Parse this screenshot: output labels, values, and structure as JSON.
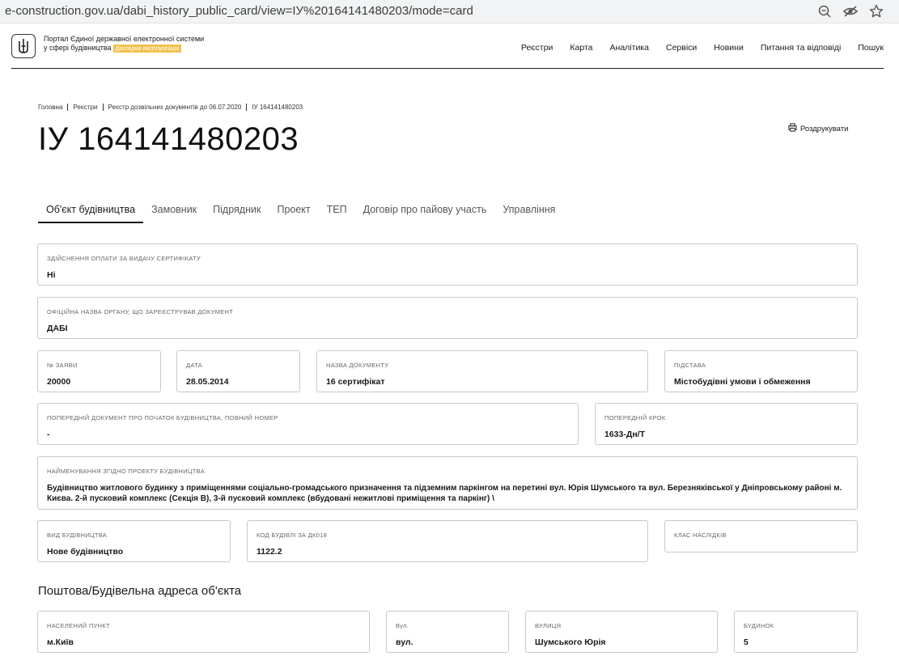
{
  "browser": {
    "url": "e-construction.gov.ua/dabi_history_public_card/view=ІУ%20164141480203/mode=card"
  },
  "header": {
    "portal_title": "Портал Єдиної державної електронної системи у сфері будівництва",
    "beta_badge": "Дослідна експлуатація",
    "nav": [
      "Реєстри",
      "Карта",
      "Аналітика",
      "Сервіси",
      "Новини",
      "Питання та відповіді",
      "Пошук"
    ]
  },
  "breadcrumb": [
    "Головна",
    "Реєстри",
    "Реєстр дозвільних документів до 06.07.2020",
    "ІУ 164141480203"
  ],
  "page": {
    "title": "ІУ 164141480203",
    "print_label": "Роздрукувати"
  },
  "tabs": [
    "Об'єкт будівництва",
    "Замовник",
    "Підрядник",
    "Проект",
    "ТЕП",
    "Договір про пайову участь",
    "Управління"
  ],
  "fields": {
    "payment": {
      "label": "Здійснення оплати за видачу сертифікату",
      "value": "Ні"
    },
    "authority": {
      "label": "Офіційна назва органу, що зареєстрував документ",
      "value": "ДАБІ"
    },
    "app_no": {
      "label": "№ заяви",
      "value": "20000"
    },
    "date": {
      "label": "Дата",
      "value": "28.05.2014"
    },
    "doc_name": {
      "label": "Назва документу",
      "value": "16 сертифікат"
    },
    "basis": {
      "label": "Підстава",
      "value": "Містобудівні умови і обмеження"
    },
    "prev_doc": {
      "label": "Попередній документ про початок будівництва, повний номер",
      "value": "-"
    },
    "prev_step": {
      "label": "Попередній крок",
      "value": "1633-Дн/Т"
    },
    "project_name": {
      "label": "Найменування згідно проекту будівництва",
      "value": "Будівництво житлового будинку з приміщеннями соціально-громадського призначення та підземним паркінгом на перетині вул. Юрія Шумського та вул. Березняківської у Дніпровському районі м. Києва. 2-й пусковий комплекс (Секція В), 3-й пусковий комплекс (вбудовані нежитлові приміщення та паркінг) \\"
    },
    "construction_type": {
      "label": "Вид будівництва",
      "value": "Нове будівництво"
    },
    "building_code": {
      "label": "Код будівлі за ДК018",
      "value": "1122.2"
    },
    "consequence_class": {
      "label": "Клас наслідків",
      "value": ""
    }
  },
  "address": {
    "title": "Поштова/Будівельна адреса об'єкта",
    "settlement": {
      "label": "Населений пункт",
      "value": "м.Київ"
    },
    "street_type": {
      "label": "Вул.",
      "value": "вул."
    },
    "street": {
      "label": "Вулиця",
      "value": "Шумського Юрія"
    },
    "building": {
      "label": "Будинок",
      "value": "5"
    }
  }
}
